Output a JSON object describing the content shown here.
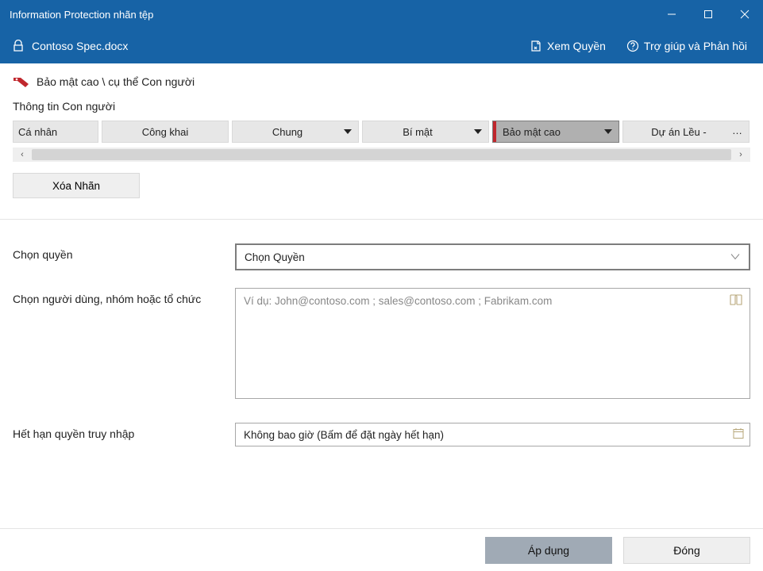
{
  "titlebar": {
    "title": "Information Protection nhãn tệp"
  },
  "subbar": {
    "filename": "Contoso Spec.docx",
    "view_perms": "Xem Quyền",
    "help": "Trợ giúp và Phản hồi"
  },
  "classification": {
    "path": "Bảo mật cao \\ cụ thể Con người",
    "section_label": "Thông tin Con người"
  },
  "labels": {
    "items": [
      {
        "text": "Cá nhân",
        "dropdown": false,
        "selected": false,
        "w": "w1"
      },
      {
        "text": "Công khai",
        "dropdown": false,
        "selected": false,
        "w": "w2"
      },
      {
        "text": "Chung",
        "dropdown": true,
        "selected": false,
        "w": "w2"
      },
      {
        "text": "Bí mật",
        "dropdown": true,
        "selected": false,
        "w": "w2"
      },
      {
        "text": "Bảo mật cao",
        "dropdown": true,
        "selected": true,
        "w": "w2"
      },
      {
        "text": "Dự án Lều -",
        "dropdown": false,
        "selected": false,
        "w": "w2",
        "ellipsis": "…"
      }
    ],
    "delete_label": "Xóa Nhãn"
  },
  "form": {
    "perm_label": "Chọn quyền",
    "perm_value": "Chọn Quyền",
    "users_label": "Chọn người dùng, nhóm hoặc tổ chức",
    "users_placeholder": "Ví dụ: John@contoso.com ; sales@contoso.com ; Fabrikam.com",
    "expire_label": "Hết hạn quyền truy nhập",
    "expire_value": "Không bao giờ (Bấm để đặt ngày hết hạn)"
  },
  "footer": {
    "apply": "Áp dụng",
    "close": "Đóng"
  },
  "scroll": {
    "left": "‹",
    "right": "›"
  }
}
